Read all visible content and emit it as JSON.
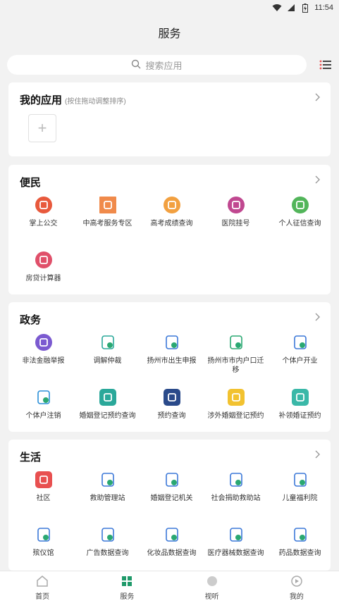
{
  "status": {
    "time": "11:54"
  },
  "header": {
    "title": "服务"
  },
  "search": {
    "placeholder": "搜索应用"
  },
  "my_apps": {
    "title": "我的应用",
    "subtitle": "(按住拖动调整排序)",
    "add": "+"
  },
  "convenience": {
    "title": "便民",
    "items": [
      {
        "label": "掌上公交",
        "icon": "bus-icon",
        "color": "#e8593c"
      },
      {
        "label": "中高考服务专区",
        "icon": "exam-banner-icon",
        "color": "#f08a4b"
      },
      {
        "label": "高考成绩查询",
        "icon": "score-icon",
        "color": "#f2a040"
      },
      {
        "label": "医院挂号",
        "icon": "hospital-icon",
        "color": "#c04890"
      },
      {
        "label": "个人征信查询",
        "icon": "credit-icon",
        "color": "#52b55a"
      },
      {
        "label": "房贷计算器",
        "icon": "house-calc-icon",
        "color": "#e0506a"
      }
    ]
  },
  "government": {
    "title": "政务",
    "items": [
      {
        "label": "非法金融举报",
        "icon": "shield-icon",
        "color": "#7b5ad0"
      },
      {
        "label": "调解仲裁",
        "icon": "handshake-icon",
        "color": "#2aa89a"
      },
      {
        "label": "扬州市出生申报",
        "icon": "birth-form-icon",
        "color": "#3b78d8"
      },
      {
        "label": "扬州市市内户口迁移",
        "icon": "folder-transfer-icon",
        "color": "#2aa872"
      },
      {
        "label": "个体户开业",
        "icon": "shop-icon",
        "color": "#3b78d8"
      },
      {
        "label": "个体户注销",
        "icon": "exit-icon",
        "color": "#2a8fd8"
      },
      {
        "label": "婚姻登记预约查询",
        "icon": "couple-icon",
        "color": "#2aa89a"
      },
      {
        "label": "预约查询",
        "icon": "v-logo-icon",
        "color": "#2a4a8a"
      },
      {
        "label": "涉外婚姻登记预约",
        "icon": "note-icon",
        "color": "#f2c230"
      },
      {
        "label": "补领婚证预约",
        "icon": "certificate-icon",
        "color": "#3ab8a8"
      }
    ]
  },
  "life": {
    "title": "生活",
    "items": [
      {
        "label": "社区",
        "icon": "community-icon",
        "color": "#e85050"
      },
      {
        "label": "救助管理站",
        "icon": "rescue-icon",
        "color": "#3b78d8"
      },
      {
        "label": "婚姻登记机关",
        "icon": "marriage-office-icon",
        "color": "#3b78d8"
      },
      {
        "label": "社会捐助救助站",
        "icon": "donation-icon",
        "color": "#3b78d8"
      },
      {
        "label": "儿童福利院",
        "icon": "child-welfare-icon",
        "color": "#3b78d8"
      },
      {
        "label": "殡仪馆",
        "icon": "funeral-icon",
        "color": "#3b78d8"
      },
      {
        "label": "广告数据查询",
        "icon": "ad-icon",
        "color": "#3b78d8"
      },
      {
        "label": "化妆品数据查询",
        "icon": "cosmetics-icon",
        "color": "#3b78d8"
      },
      {
        "label": "医疗器械数据查询",
        "icon": "stethoscope-icon",
        "color": "#3b78d8"
      },
      {
        "label": "药品数据查询",
        "icon": "medicine-icon",
        "color": "#3b78d8"
      }
    ]
  },
  "nav": [
    {
      "label": "首页",
      "icon": "home-icon",
      "active": false
    },
    {
      "label": "服务",
      "icon": "service-grid-icon",
      "active": true
    },
    {
      "label": "视听",
      "icon": "media-icon",
      "active": false
    },
    {
      "label": "我的",
      "icon": "profile-icon",
      "active": false
    }
  ],
  "colors": {
    "accent": "#1f9a6a",
    "background": "#f2f2f2"
  }
}
